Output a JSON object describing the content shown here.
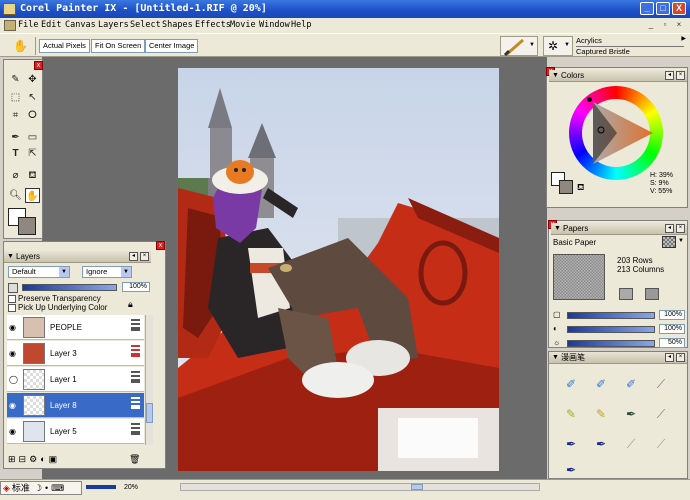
{
  "window": {
    "title": "Corel Painter IX - [Untitled-1.RIF @ 20%]",
    "min": "_",
    "max": "□",
    "close": "X"
  },
  "menu": [
    "File",
    "Edit",
    "Canvas",
    "Layers",
    "Select",
    "Shapes",
    "Effects",
    "Movie",
    "Window",
    "Help"
  ],
  "propbar": {
    "actual_pixels": "Actual Pixels",
    "fit_on_screen": "Fit On Screen",
    "center_image": "Center Image"
  },
  "brush": {
    "category": "Acrylics",
    "variant": "Captured Bristle"
  },
  "colors": {
    "title": "Colors",
    "h": "H: 39%",
    "s": "S: 9%",
    "v": "V: 55%",
    "accent": "#e0712d"
  },
  "papers": {
    "title": "Papers",
    "paper": "Basic Paper",
    "rows": "203 Rows",
    "cols": "213 Columns",
    "scale": "100%",
    "contrast": "100%",
    "brightness": "50%"
  },
  "brushpanel": {
    "title": "漫画笔"
  },
  "layers": {
    "title": "Layers",
    "composite": "Default",
    "method": "Ignore",
    "opacity": "100%",
    "preserve": "Preserve Transparency",
    "pickup": "Pick Up Underlying Color",
    "items": [
      {
        "name": "PEOPLE"
      },
      {
        "name": "Layer 3"
      },
      {
        "name": "Layer 1"
      },
      {
        "name": "Layer 8"
      },
      {
        "name": "Layer 5"
      }
    ]
  },
  "status": {
    "ime": "标准",
    "zoom": "20%"
  }
}
